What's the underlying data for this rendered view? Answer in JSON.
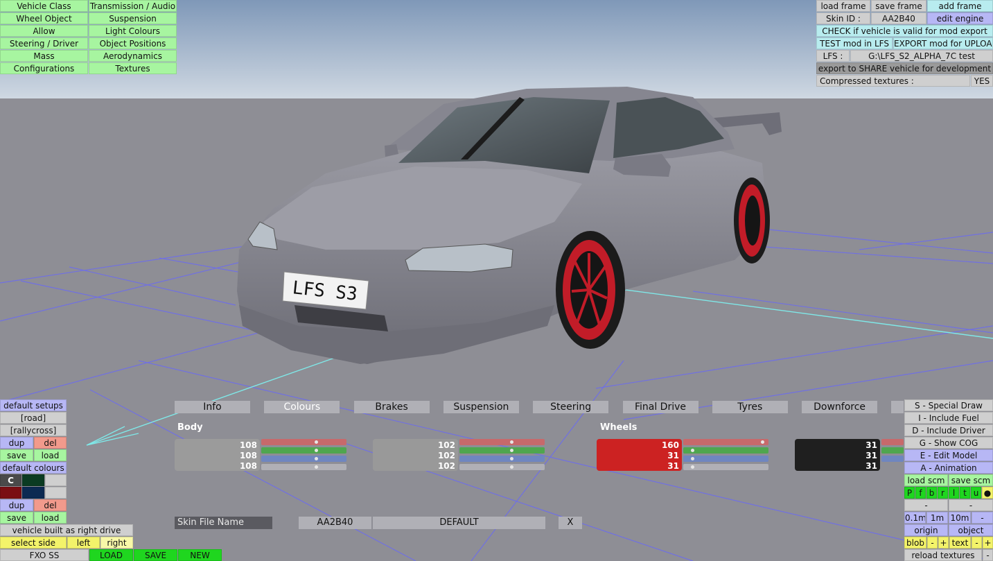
{
  "menu_left": [
    [
      "Vehicle Class",
      "Transmission / Audio"
    ],
    [
      "Wheel Object",
      "Suspension"
    ],
    [
      "Allow",
      "Light Colours"
    ],
    [
      "Steering / Driver",
      "Object Positions"
    ],
    [
      "Mass",
      "Aerodynamics"
    ],
    [
      "Configurations",
      "Textures"
    ]
  ],
  "top_right": {
    "load_frame": "load frame",
    "save_frame": "save frame",
    "add_frame": "add frame",
    "skin_id_label": "Skin ID :",
    "skin_id_value": "AA2B40",
    "edit_engine": "edit engine",
    "check_valid": "CHECK if vehicle is valid for mod export",
    "test_mod": "TEST mod in LFS",
    "export_mod": "EXPORT mod for UPLOAD",
    "lfs_label": "LFS :",
    "lfs_path": "G:\\LFS_S2_ALPHA_7C test",
    "export_share": "export to SHARE vehicle for development",
    "compressed_label": "Compressed textures :",
    "compressed_value": "YES"
  },
  "plate_text": "LFS S3",
  "tabs": [
    "Info",
    "Colours",
    "Brakes",
    "Suspension",
    "Steering",
    "Final Drive",
    "Tyres",
    "Downforce"
  ],
  "active_tab": "Colours",
  "body_label": "Body",
  "wheels_label": "Wheels",
  "colour_groups": [
    {
      "values": [
        "108",
        "108",
        "108"
      ],
      "swatch": "#9b9b9b",
      "slider_pos": [
        0.65,
        0.65,
        0.65,
        0.65
      ]
    },
    {
      "values": [
        "102",
        "102",
        "102"
      ],
      "swatch": "#999999",
      "slider_pos": [
        0.62,
        0.62,
        0.62,
        0.62
      ]
    },
    {
      "values": [
        "160",
        "31",
        "31"
      ],
      "swatch": "#cc2222",
      "slider_pos": [
        0.96,
        0.08,
        0.08,
        0.08
      ]
    },
    {
      "values": [
        "31",
        "31",
        "31"
      ],
      "swatch": "#1f1f1f",
      "slider_pos": [
        0.5,
        0.5,
        0.5,
        0.5
      ]
    }
  ],
  "skin": {
    "label": "Skin File Name",
    "id": "AA2B40",
    "name": "DEFAULT",
    "close": "X"
  },
  "left_panel": {
    "default_setups": "default setups",
    "road": "[road]",
    "rallycross": "[rallycross]",
    "dup": "dup",
    "del": "del",
    "save": "save",
    "load": "load",
    "default_colours": "default colours",
    "c": "C",
    "built_as": "vehicle built as right drive",
    "select_side": "select side",
    "left": "left",
    "right": "right"
  },
  "bottom_bar": {
    "fxo": "FXO SS",
    "load": "LOAD",
    "save": "SAVE",
    "new": "NEW"
  },
  "right_panel": {
    "special_draw": "S - Special Draw",
    "include_fuel": "I - Include Fuel",
    "include_driver": "D - Include Driver",
    "show_cog": "G - Show COG",
    "edit_model": "E - Edit Model",
    "animation": "A - Animation",
    "load_scm": "load scm",
    "save_scm": "save scm",
    "flags": [
      "P",
      "f",
      "b",
      "r",
      "l",
      "t",
      "u"
    ],
    "minus": "-",
    "step_01": "0.1m",
    "step_1": "1m",
    "step_10": "10m",
    "origin": "origin",
    "object": "object",
    "blob": "blob",
    "plus": "+",
    "text": "text",
    "reload_textures": "reload textures"
  },
  "colors": {
    "sky_top": "#7f98b8",
    "ground": "#8e8e95",
    "grid": "#6b6bf0",
    "axis": "#7fe8e8",
    "menu_green": "#a7f5a0",
    "menu_blue": "#b7b7f5",
    "car_body": "#7c7c86",
    "rim": "#c21c28"
  }
}
